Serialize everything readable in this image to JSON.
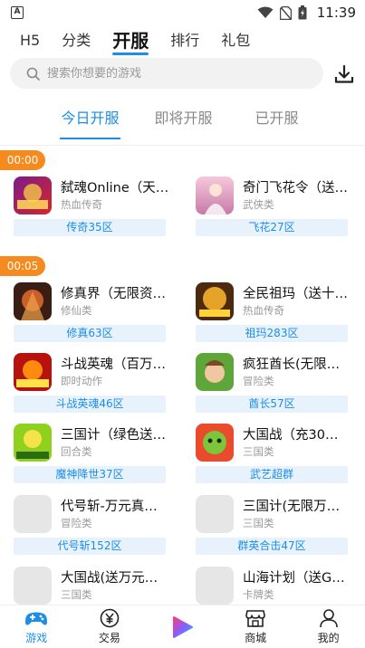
{
  "status_bar": {
    "app_letter": "A",
    "time": "11:39"
  },
  "top_nav": {
    "tabs": [
      "H5",
      "分类",
      "开服",
      "排行",
      "礼包"
    ],
    "active_index": 2
  },
  "search": {
    "placeholder": "搜索你想要的游戏"
  },
  "sub_tabs": {
    "tabs": [
      "今日开服",
      "即将开服",
      "已开服"
    ],
    "active_index": 0
  },
  "groups": [
    {
      "time": "00:00",
      "games": [
        {
          "name": "弑魂Online（天…",
          "genre": "热血传奇",
          "server": "传奇35区",
          "thumb": "red"
        },
        {
          "name": "奇门飞花令（送…",
          "genre": "武侠类",
          "server": "飞花27区",
          "thumb": "pink"
        }
      ]
    },
    {
      "time": "00:05",
      "games": [
        {
          "name": "修真界（无限资…",
          "genre": "修仙类",
          "server": "修真63区",
          "thumb": "dark"
        },
        {
          "name": "全民祖玛（送十…",
          "genre": "热血传奇",
          "server": "祖玛283区",
          "thumb": "gold"
        },
        {
          "name": "斗战英魂（百万…",
          "genre": "即时动作",
          "server": "斗战英魂46区",
          "thumb": "fire"
        },
        {
          "name": "疯狂酋长(无限…",
          "genre": "冒险类",
          "server": "酋长57区",
          "thumb": "green"
        },
        {
          "name": "三国计（绿色送…",
          "genre": "回合类",
          "server": "魔神降世37区",
          "thumb": "lime"
        },
        {
          "name": "大国战（充30…",
          "genre": "三国类",
          "server": "武艺超群",
          "thumb": "cartoon"
        },
        {
          "name": "代号斩-万元真…",
          "genre": "冒险类",
          "server": "代号斩152区",
          "thumb": "blank"
        },
        {
          "name": "三国计(无限万…",
          "genre": "三国类",
          "server": "群英合击47区",
          "thumb": "blank"
        },
        {
          "name": "大国战(送万元…",
          "genre": "三国类",
          "server": "",
          "thumb": "blank"
        },
        {
          "name": "山海计划（送G…",
          "genre": "卡牌类",
          "server": "",
          "thumb": "blank"
        }
      ]
    }
  ],
  "bottom_nav": [
    {
      "label": "游戏",
      "icon": "gamepad-icon",
      "active": true
    },
    {
      "label": "交易",
      "icon": "yen-bag-icon",
      "active": false
    },
    {
      "label": "",
      "icon": "play-logo-icon",
      "active": false
    },
    {
      "label": "商城",
      "icon": "shop-icon",
      "active": false
    },
    {
      "label": "我的",
      "icon": "user-icon",
      "active": false
    }
  ],
  "colors": {
    "accent": "#1b8ee8",
    "time_badge": "#f58a1f",
    "server_bg": "#e8f2fd"
  }
}
